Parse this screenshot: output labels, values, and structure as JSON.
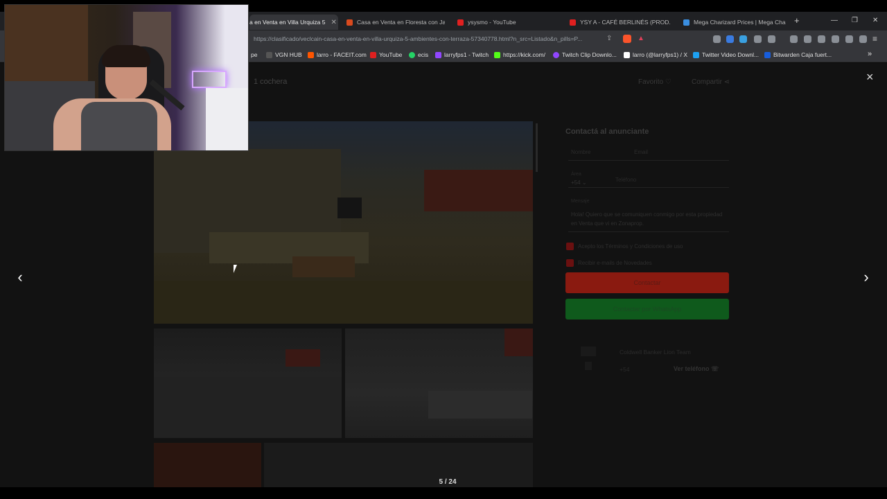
{
  "tabs": [
    {
      "title": "a en Venta en Villa Urquiza 5",
      "active": true,
      "fav": "#d94a1e"
    },
    {
      "title": "Casa en Venta en Floresta con Jardin",
      "active": false,
      "fav": "#d94a1e"
    },
    {
      "title": "ysysmo - YouTube",
      "active": false,
      "fav": "#e02020"
    },
    {
      "title": "YSY A - CAFÉ BERLINÉS (PROD. EVLA",
      "active": false,
      "fav": "#e02020"
    },
    {
      "title": "Mega Charizard Prices | Mega Chari",
      "active": false,
      "fav": "#3a8ee0"
    }
  ],
  "new_tab": "+",
  "address": "https://clasificado/veclcain-casa-en-venta-en-villa-urquiza-5-ambientes-con-terraza-57340778.html?n_src=Listado&n_pills=P...",
  "bookmarks": [
    {
      "label": "pe",
      "color": "#888"
    },
    {
      "label": "VGN HUB",
      "color": "#555"
    },
    {
      "label": "larro - FACEIT.com",
      "color": "#ff5500"
    },
    {
      "label": "YouTube",
      "color": "#e02020"
    },
    {
      "label": "ecis",
      "color": "#25d366"
    },
    {
      "label": "larryfps1 - Twitch",
      "color": "#9146ff"
    },
    {
      "label": "https://kick.com/",
      "color": "#53fc18"
    },
    {
      "label": "Twitch Clip Downlo...",
      "color": "#9146ff"
    },
    {
      "label": "larro (@larryfps1) / X",
      "color": "#ffffff"
    },
    {
      "label": "Twitter Video Downl...",
      "color": "#1da1f2"
    },
    {
      "label": "Bitwarden Caja fuert...",
      "color": "#175ddc"
    }
  ],
  "bookmarks_more": "»",
  "listing": {
    "header_left": "1 cochera",
    "favorite": "Favorito",
    "share": "Compartir",
    "close": "×"
  },
  "contact": {
    "title": "Contactá al anunciante",
    "name_placeholder": "Nombre",
    "email_placeholder": "Email",
    "area_label": "Área",
    "area_value": "+54",
    "phone_placeholder": "Teléfono",
    "message_label": "Mensaje",
    "message": "Hola! Quiero que se comuniquen conmigo por esta propiedad en Venta que vi en Zonaprop.",
    "check1": "Acepto los Términos y Condiciones de uso",
    "check2": "Recibir e-mails de Novedades",
    "contact_button": "Contactar",
    "whatsapp_button": "Contactar por WhatsApp",
    "agency": "Coldwell Banker Lion Team",
    "phone_prefix": "+54",
    "see_phone": "Ver teléfono"
  },
  "gallery": {
    "counter": "5 / 24",
    "prev": "‹",
    "next": "›"
  },
  "colors": {
    "contact_button": "#8a1a10",
    "whatsapp_button": "#0f5a1c",
    "checkbox": "#6a1010"
  }
}
